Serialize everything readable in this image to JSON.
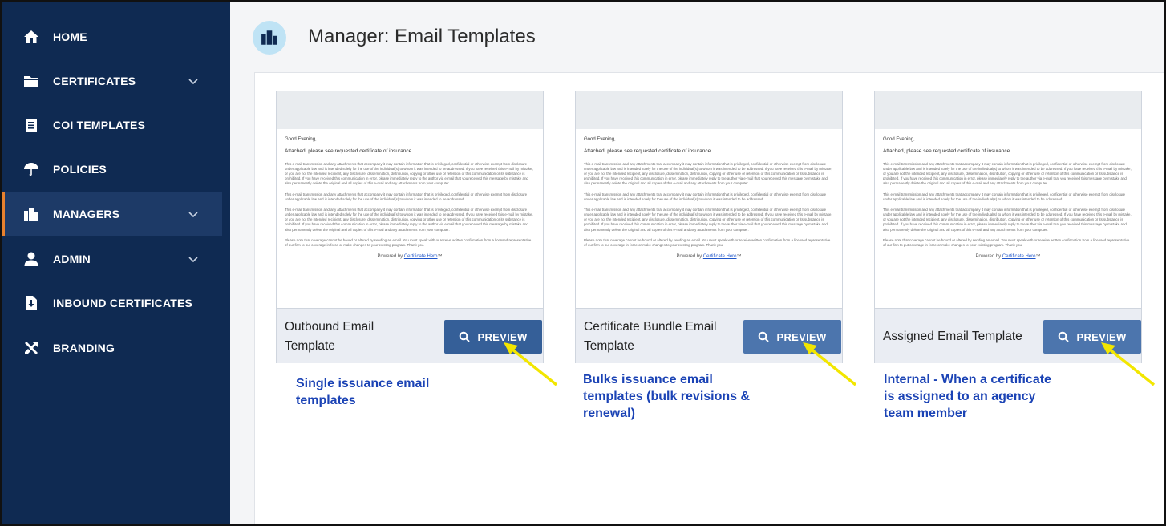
{
  "sidebar": {
    "items": [
      {
        "label": "HOME",
        "icon": "home-icon",
        "chevron": false,
        "active": false
      },
      {
        "label": "CERTIFICATES",
        "icon": "folder-icon",
        "chevron": true,
        "active": false
      },
      {
        "label": "COI TEMPLATES",
        "icon": "document-icon",
        "chevron": false,
        "active": false
      },
      {
        "label": "POLICIES",
        "icon": "umbrella-icon",
        "chevron": false,
        "active": false
      },
      {
        "label": "MANAGERS",
        "icon": "buildings-icon",
        "chevron": true,
        "active": true
      },
      {
        "label": "ADMIN",
        "icon": "user-icon",
        "chevron": true,
        "active": false
      },
      {
        "label": "INBOUND CERTIFICATES",
        "icon": "download-file-icon",
        "chevron": false,
        "active": false
      },
      {
        "label": "BRANDING",
        "icon": "tools-icon",
        "chevron": false,
        "active": false
      }
    ]
  },
  "header": {
    "title": "Manager: Email Templates",
    "icon": "buildings-icon"
  },
  "email_preview": {
    "greeting": "Good Evening,",
    "attached": "Attached, please see requested certificate of insurance.",
    "para1": "This e-mail transmission and any attachments that accompany it may contain information that is privileged, confidential or otherwise exempt from disclosure under applicable law and is intended solely for the use of the individual(s) to whom it was intended to be addressed. If you have received this e-mail by mistake, or you are not the intended recipient, any disclosure, dissemination, distribution, copying or other use or retention of this communication or its substance is prohibited. If you have received this communication in error, please immediately reply to the author via e-mail that you received this message by mistake and also permanently delete the original and all copies of this e-mail and any attachments from your computer.",
    "para2": "This e-mail transmission and any attachments that accompany it may contain information that is privileged, confidential or otherwise exempt from disclosure under applicable law and is intended solely for the use of the individual(s) to whom it was intended to be addressed.",
    "para3": "This e-mail transmission and any attachments that accompany it may contain information that is privileged, confidential or otherwise exempt from disclosure under applicable law and is intended solely for the use of the individual(s) to whom it was intended to be addressed. If you have received this e-mail by mistake, or you are not the intended recipient, any disclosure, dissemination, distribution, copying or other use or retention of this communication or its substance is prohibited. If you have received this communication in error, please immediately reply to the author via e-mail that you received this message by mistake and also permanently delete the original and all copies of this e-mail and any attachments from your computer.",
    "para4": "Please note that coverage cannot be bound or altered by sending an email. You must speak with or receive written confirmation from a licensed representative of our firm to put coverage in force or make changes to your existing program. Thank you.",
    "powered_prefix": "Powered by",
    "powered_link": "Certificate Hero",
    "powered_suffix": "™"
  },
  "cards": [
    {
      "name_line1": "Outbound Email",
      "name_line2": "Template",
      "button": "PREVIEW",
      "annotation_lines": [
        "Single issuance email",
        "templates"
      ]
    },
    {
      "name_line1": "Certificate Bundle Email",
      "name_line2": "Template",
      "button": "PREVIEW",
      "annotation_lines": [
        "Bulks issuance email",
        "templates (bulk revisions &",
        "renewal)"
      ]
    },
    {
      "name_line1": "Assigned Email Template",
      "name_line2": "",
      "button": "PREVIEW",
      "annotation_lines": [
        "Internal - When a certificate",
        "is assigned to an agency",
        "team member"
      ]
    }
  ],
  "colors": {
    "sidebar": "#0f2a52",
    "active_accent": "#e8812e",
    "button": "#355f98",
    "annotation": "#1b43b5",
    "arrow": "#f2e600"
  }
}
